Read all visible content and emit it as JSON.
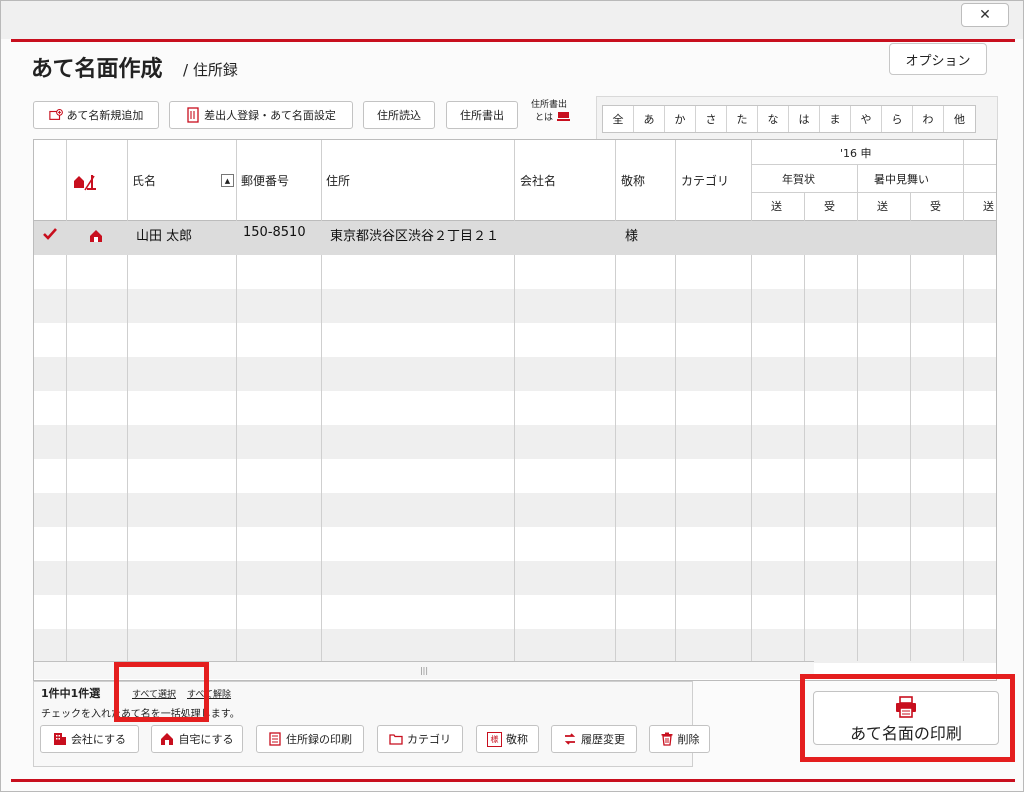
{
  "window": {
    "close_label": "✕"
  },
  "header": {
    "title": "あて名面作成",
    "subtitle": "/ 住所録",
    "options_label": "オプション"
  },
  "toolbar": {
    "add_new": "あて名新規追加",
    "sender_setup": "差出人登録・あて名面設定",
    "import": "住所読込",
    "export": "住所書出",
    "export_help_line1": "住所書出",
    "export_help_line2": "とは"
  },
  "kana_filter": [
    "全",
    "あ",
    "か",
    "さ",
    "た",
    "な",
    "は",
    "ま",
    "や",
    "ら",
    "わ",
    "他"
  ],
  "table": {
    "headers": {
      "name": "氏名",
      "postal": "郵便番号",
      "address": "住所",
      "company": "会社名",
      "honorific": "敬称",
      "category": "カテゴリ",
      "year_group": "'16 申",
      "nenga": "年賀状",
      "shochu": "暑中見舞い",
      "send": "送",
      "recv": "受"
    },
    "rows": [
      {
        "name": "山田 太郎",
        "postal": "150-8510",
        "address": "東京都渋谷区渋谷２丁目２１",
        "company": "",
        "honorific": "様",
        "category": ""
      }
    ]
  },
  "status": {
    "count_text": "1件中1件選",
    "select_all": "すべて選択",
    "deselect_all": "すべて解除",
    "instruction": "チェックを入れたあて名を一括処理します。"
  },
  "bottom_buttons": {
    "to_company": "会社にする",
    "to_home": "自宅にする",
    "print_list": "住所録の印刷",
    "category": "カテゴリ",
    "honorific": "敬称",
    "history": "履歴変更",
    "delete": "削除"
  },
  "print_button": {
    "label": "あて名面の印刷"
  },
  "colors": {
    "accent": "#c80f1e",
    "highlight": "#e41e1e",
    "selected_row": "#dcdcdc",
    "stripe": "#efefef"
  }
}
